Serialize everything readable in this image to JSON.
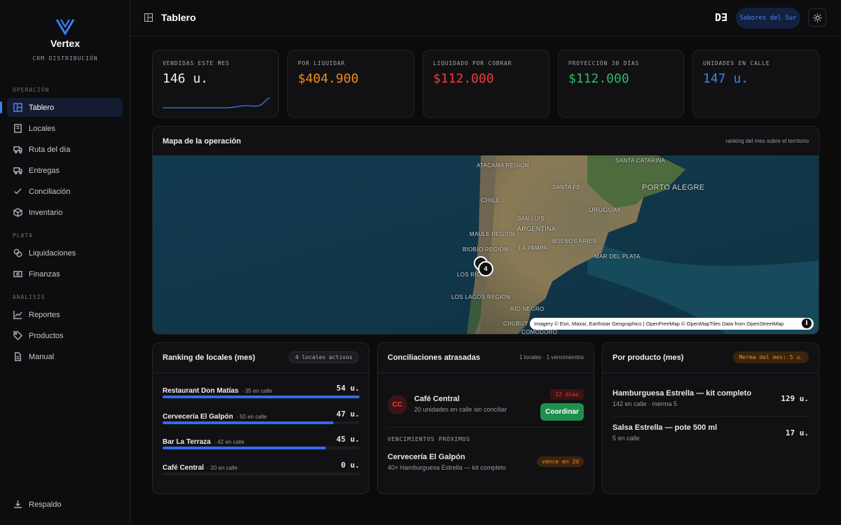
{
  "sidebar": {
    "brand": "Vertex",
    "brand_sub": "CRM DISTRIBUCIÓN",
    "sections": [
      "OPERACIÓN",
      "PLATA",
      "ANÁLISIS"
    ],
    "items": [
      {
        "label": "Tablero",
        "icon": "dashboard-icon"
      },
      {
        "label": "Locales",
        "icon": "building-icon"
      },
      {
        "label": "Ruta del día",
        "icon": "truck-icon"
      },
      {
        "label": "Entregas",
        "icon": "delivery-truck-icon"
      },
      {
        "label": "Conciliación",
        "icon": "check-icon"
      },
      {
        "label": "Inventario",
        "icon": "box-icon"
      },
      {
        "label": "Liquidaciones",
        "icon": "coins-icon"
      },
      {
        "label": "Finanzas",
        "icon": "banknote-icon"
      },
      {
        "label": "Reportes",
        "icon": "line-chart-icon"
      },
      {
        "label": "Productos",
        "icon": "tag-icon"
      },
      {
        "label": "Manual",
        "icon": "file-icon"
      }
    ],
    "backup": "Respaldo"
  },
  "header": {
    "title": "Tablero",
    "logo_text": "D∃",
    "tenant": "Sabores del Sur"
  },
  "kpis": [
    {
      "label": "VENDIDAS ESTE MES",
      "value": "146 u.",
      "color": "#f0f0f2"
    },
    {
      "label": "POR LIQUIDAR",
      "value": "$404.900",
      "color": "#f08a24"
    },
    {
      "label": "LIQUIDADO POR COBRAR",
      "value": "$112.000",
      "color": "#ef3b3b"
    },
    {
      "label": "PROYECCIÓN 30 DÍAS",
      "value": "$112.000",
      "color": "#2fb865"
    },
    {
      "label": "UNIDADES EN CALLE",
      "value": "147 u.",
      "color": "#3b82f6"
    }
  ],
  "map": {
    "title": "Mapa de la operación",
    "subtitle": "ranking del mes sobre el territorio",
    "attribution": "Imagery © Esri, Maxar, Earthstar Geographics | OpenFreeMap © OpenMapTiles Data from OpenStreetMap",
    "cluster": "4",
    "labels": [
      "ATACAMA REGION",
      "SANTA CATARINA",
      "PORTO ALEGRE",
      "SANTA FE",
      "CHILE",
      "URUGUAY",
      "SAN LUIS",
      "ARGENTINA",
      "MAULE REGION",
      "BUENOS AIRES",
      "BIOBÍO REGION",
      "LA PAMPA",
      "MAR DEL PLATA",
      "LOS RÍOS",
      "LOS LAGOS REGION",
      "RÍO NEGRO",
      "CHUBUT",
      "COMODORO"
    ]
  },
  "ranking": {
    "title": "Ranking de locales (mes)",
    "badge": "4 locales activos",
    "rows": [
      {
        "name": "Restaurant Don Matías",
        "sub": "· 35 en calle",
        "value": "54 u.",
        "fill": 1.0
      },
      {
        "name": "Cervecería El Galpón",
        "sub": "· 50 en calle",
        "value": "47 u.",
        "fill": 0.87
      },
      {
        "name": "Bar La Terraza",
        "sub": "· 42 en calle",
        "value": "45 u.",
        "fill": 0.83
      },
      {
        "name": "Café Central",
        "sub": "· 20 en calle",
        "value": "0 u.",
        "fill": 0
      }
    ]
  },
  "conc": {
    "title": "Conciliaciones atrasadas",
    "meta": "1 locales · 1 vencimientos",
    "item": {
      "initials": "CC",
      "name": "Café Central",
      "desc": "20 unidades en calle sin conciliar",
      "days": "22 días",
      "action": "Coordinar"
    },
    "section": "VENCIMIENTOS PRÓXIMOS",
    "due": {
      "name": "Cervecería El Galpón",
      "desc": "40× Hamburguesa Estrella — kit completo",
      "badge": "vence en 2d"
    }
  },
  "products": {
    "title": "Por producto (mes)",
    "badge": "Merma del mes: 5 u.",
    "rows": [
      {
        "name": "Hamburguesa Estrella — kit completo",
        "sub": "142 en calle · merma 5",
        "value": "129 u."
      },
      {
        "name": "Salsa Estrella — pote 500 ml",
        "sub": "5 en calle",
        "value": "17 u."
      }
    ]
  },
  "colors": {
    "accent": "#3b82f6",
    "orange": "#f08a24",
    "red": "#ef3b3b",
    "green": "#2fb865"
  }
}
